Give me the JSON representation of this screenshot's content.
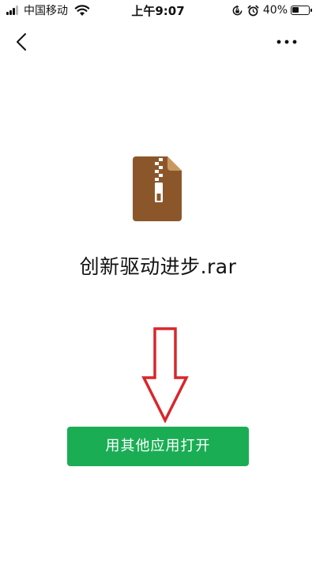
{
  "status_bar": {
    "carrier": "中国移动",
    "time": "上午9:07",
    "battery_percent": "40%",
    "battery_level": 0.4,
    "icons": [
      "signal-icon",
      "wifi-icon",
      "rotation-lock-icon",
      "alarm-icon",
      "battery-icon"
    ]
  },
  "nav": {
    "back_icon": "chevron-left-icon",
    "more_icon": "more-dots-icon"
  },
  "file": {
    "icon": "archive-file-icon",
    "name": "创新驱动进步.rar"
  },
  "actions": {
    "open_with_label": "用其他应用打开"
  },
  "annotation": {
    "icon": "red-down-arrow-icon"
  },
  "colors": {
    "button_bg": "#1aad54",
    "file_icon": "#8b572a",
    "arrow_outline": "#d9262c"
  }
}
